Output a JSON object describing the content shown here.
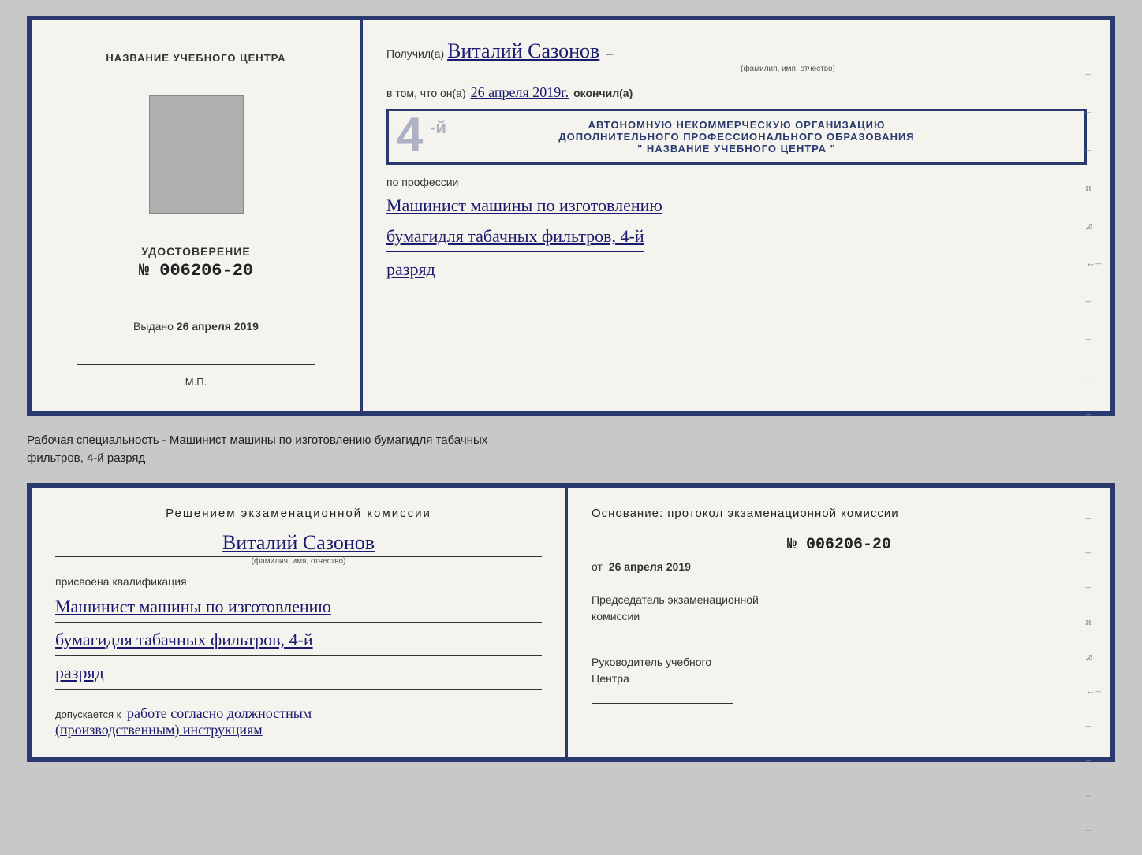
{
  "top_document": {
    "left": {
      "center_name_label": "НАЗВАНИЕ УЧЕБНОГО ЦЕНТРА",
      "udostoverenie_title": "УДОСТОВЕРЕНИЕ",
      "udostoverenie_number": "№ 006206-20",
      "vydano_label": "Выдано",
      "vydano_date": "26 апреля 2019",
      "mp_label": "М.П."
    },
    "right": {
      "poluchil_prefix": "Получил(а)",
      "handwritten_name": "Виталий Сазонов",
      "name_hint": "(фамилия, имя, отчество)",
      "vtom_prefix": "в том, что он(а)",
      "handwritten_date": "26 апреля 2019г.",
      "okончил_label": "окончил(а)",
      "stamp_line1": "АВТОНОМНУЮ НЕКОММЕРЧЕСКУЮ ОРГАНИЗАЦИЮ",
      "stamp_line2": "ДОПОЛНИТЕЛЬНОГО ПРОФЕССИОНАЛЬНОГО ОБРАЗОВАНИЯ",
      "stamp_line3": "\"  НАЗВАНИЕ УЧЕБНОГО ЦЕНТРА  \"",
      "po_professii_label": "по профессии",
      "profession_line1": "Машинист машины по изготовлению",
      "profession_line2": "бумагидля табачных фильтров, 4-й",
      "profession_line3": "разряд",
      "dashes": [
        "-",
        "-",
        "-",
        "и",
        "а",
        "←",
        "-",
        "-",
        "-",
        "-"
      ]
    }
  },
  "description": {
    "prefix": "Рабочая специальность - Машинист машины по изготовлению бумагидля табачных",
    "underlined": "фильтров, 4-й разряд"
  },
  "bottom_document": {
    "left": {
      "resheniem_title": "Решением  экзаменационной  комиссии",
      "handwritten_name": "Виталий Сазонов",
      "name_hint": "(фамилия, имя, отчество)",
      "prisvoyena_label": "присвоена квалификация",
      "qualification_line1": "Машинист машины по изготовлению",
      "qualification_line2": "бумагидля табачных фильтров, 4-й",
      "qualification_line3": "разряд",
      "dopuskaetsya_prefix": "допускается к",
      "dopuskaetsya_italic": "работе согласно должностным",
      "dopuskaetsya_italic2": "(производственным) инструкциям"
    },
    "right": {
      "osnovanie_title": "Основание: протокол экзаменационной  комиссии",
      "protocol_number": "№  006206-20",
      "ot_prefix": "от",
      "ot_date": "26 апреля 2019",
      "chairman_label": "Председатель экзаменационной",
      "chairman_label2": "комиссии",
      "director_label": "Руководитель учебного",
      "director_label2": "Центра",
      "dashes": [
        "-",
        "-",
        "-",
        "и",
        "а",
        "←",
        "-",
        "-",
        "-",
        "-"
      ]
    }
  }
}
